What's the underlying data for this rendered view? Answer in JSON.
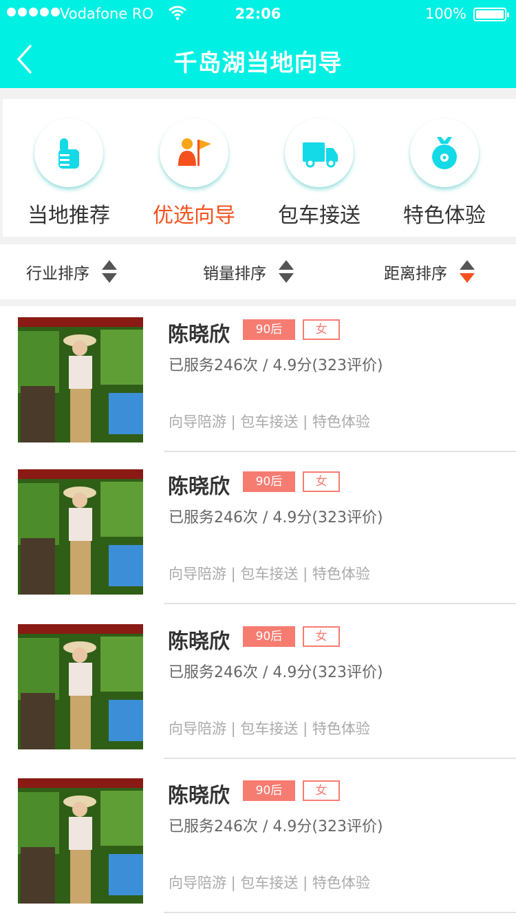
{
  "status_bar": {
    "carrier": "Vodafone RO",
    "time": "22:06",
    "battery": "100%"
  },
  "nav": {
    "title": "千岛湖当地向导"
  },
  "categories": [
    {
      "label": "当地推荐",
      "icon": "thumbs-up-icon",
      "active": false
    },
    {
      "label": "优选向导",
      "icon": "guide-flag-icon",
      "active": true
    },
    {
      "label": "包车接送",
      "icon": "truck-icon",
      "active": false
    },
    {
      "label": "特色体验",
      "icon": "medal-icon",
      "active": false
    }
  ],
  "sorts": [
    {
      "label": "行业排序"
    },
    {
      "label": "销量排序"
    },
    {
      "label": "距离排序",
      "active": true
    }
  ],
  "guides": [
    {
      "name": "陈晓欣",
      "age_tag": "90后",
      "gender_tag": "女",
      "stats": "已服务246次 / 4.9分(323评价)",
      "services": "向导陪游 | 包车接送 | 特色体验"
    },
    {
      "name": "陈晓欣",
      "age_tag": "90后",
      "gender_tag": "女",
      "stats": "已服务246次 / 4.9分(323评价)",
      "services": "向导陪游 | 包车接送 | 特色体验"
    },
    {
      "name": "陈晓欣",
      "age_tag": "90后",
      "gender_tag": "女",
      "stats": "已服务246次 / 4.9分(323评价)",
      "services": "向导陪游 | 包车接送 | 特色体验"
    },
    {
      "name": "陈晓欣",
      "age_tag": "90后",
      "gender_tag": "女",
      "stats": "已服务246次 / 4.9分(323评价)",
      "services": "向导陪游 | 包车接送 | 特色体验"
    }
  ],
  "colors": {
    "header_bg": "#00f0e4",
    "accent_orange": "#f4511e",
    "icon_cyan": "#14d9e6",
    "tag_pink": "#f67c72"
  }
}
